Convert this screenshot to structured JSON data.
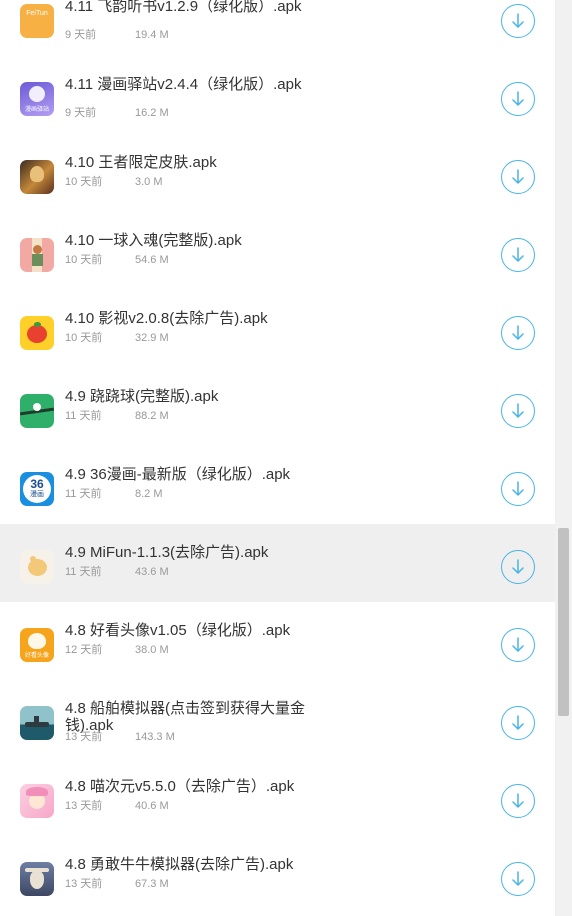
{
  "items": [
    {
      "name": "4.11 飞韵听书v1.2.9（绿化版）.apk",
      "date": "9 天前",
      "size": "19.4 M",
      "icon": "feiyun-app-icon"
    },
    {
      "name": "4.11 漫画驿站v2.4.4（绿化版）.apk",
      "date": "9 天前",
      "size": "16.2 M",
      "icon": "manhua-app-icon"
    },
    {
      "name": "4.10 王者限定皮肤.apk",
      "date": "10 天前",
      "size": "3.0 M",
      "icon": "wangzhe-app-icon"
    },
    {
      "name": "4.10 一球入魂(完整版).apk",
      "date": "10 天前",
      "size": "54.6 M",
      "icon": "yiqiu-app-icon"
    },
    {
      "name": "4.10 影视v2.0.8(去除广告).apk",
      "date": "10 天前",
      "size": "32.9 M",
      "icon": "yingshi-app-icon"
    },
    {
      "name": "4.9 跷跷球(完整版).apk",
      "date": "11 天前",
      "size": "88.2 M",
      "icon": "qiaoqiao-app-icon"
    },
    {
      "name": "4.9 36漫画-最新版（绿化版）.apk",
      "date": "11 天前",
      "size": "8.2 M",
      "icon": "36manhua-app-icon"
    },
    {
      "name": "4.9 MiFun-1.1.3(去除广告).apk",
      "date": "11 天前",
      "size": "43.6 M",
      "icon": "mifun-app-icon"
    },
    {
      "name": "4.8 好看头像v1.05（绿化版）.apk",
      "date": "12 天前",
      "size": "38.0 M",
      "icon": "haokan-app-icon"
    },
    {
      "name": "4.8 船舶模拟器(点击签到获得大量金钱).apk",
      "date": "13 天前",
      "size": "143.3 M",
      "icon": "ship-app-icon"
    },
    {
      "name": "4.8 喵次元v5.5.0（去除广告）.apk",
      "date": "13 天前",
      "size": "40.6 M",
      "icon": "miaociyuan-app-icon"
    },
    {
      "name": "4.8 勇敢牛牛模拟器(去除广告).apk",
      "date": "13 天前",
      "size": "67.3 M",
      "icon": "niuniu-app-icon"
    }
  ],
  "icon_badges": {
    "feiyun": "FeiTun",
    "manhua": "漫画驿站",
    "m36_top": "36",
    "m36_bottom": "漫画",
    "haokan": "好看头像"
  },
  "highlighted_index": 7,
  "colors": {
    "accent": "#49b4e6",
    "title": "#333333",
    "meta": "#999999",
    "highlight": "#efefef"
  }
}
